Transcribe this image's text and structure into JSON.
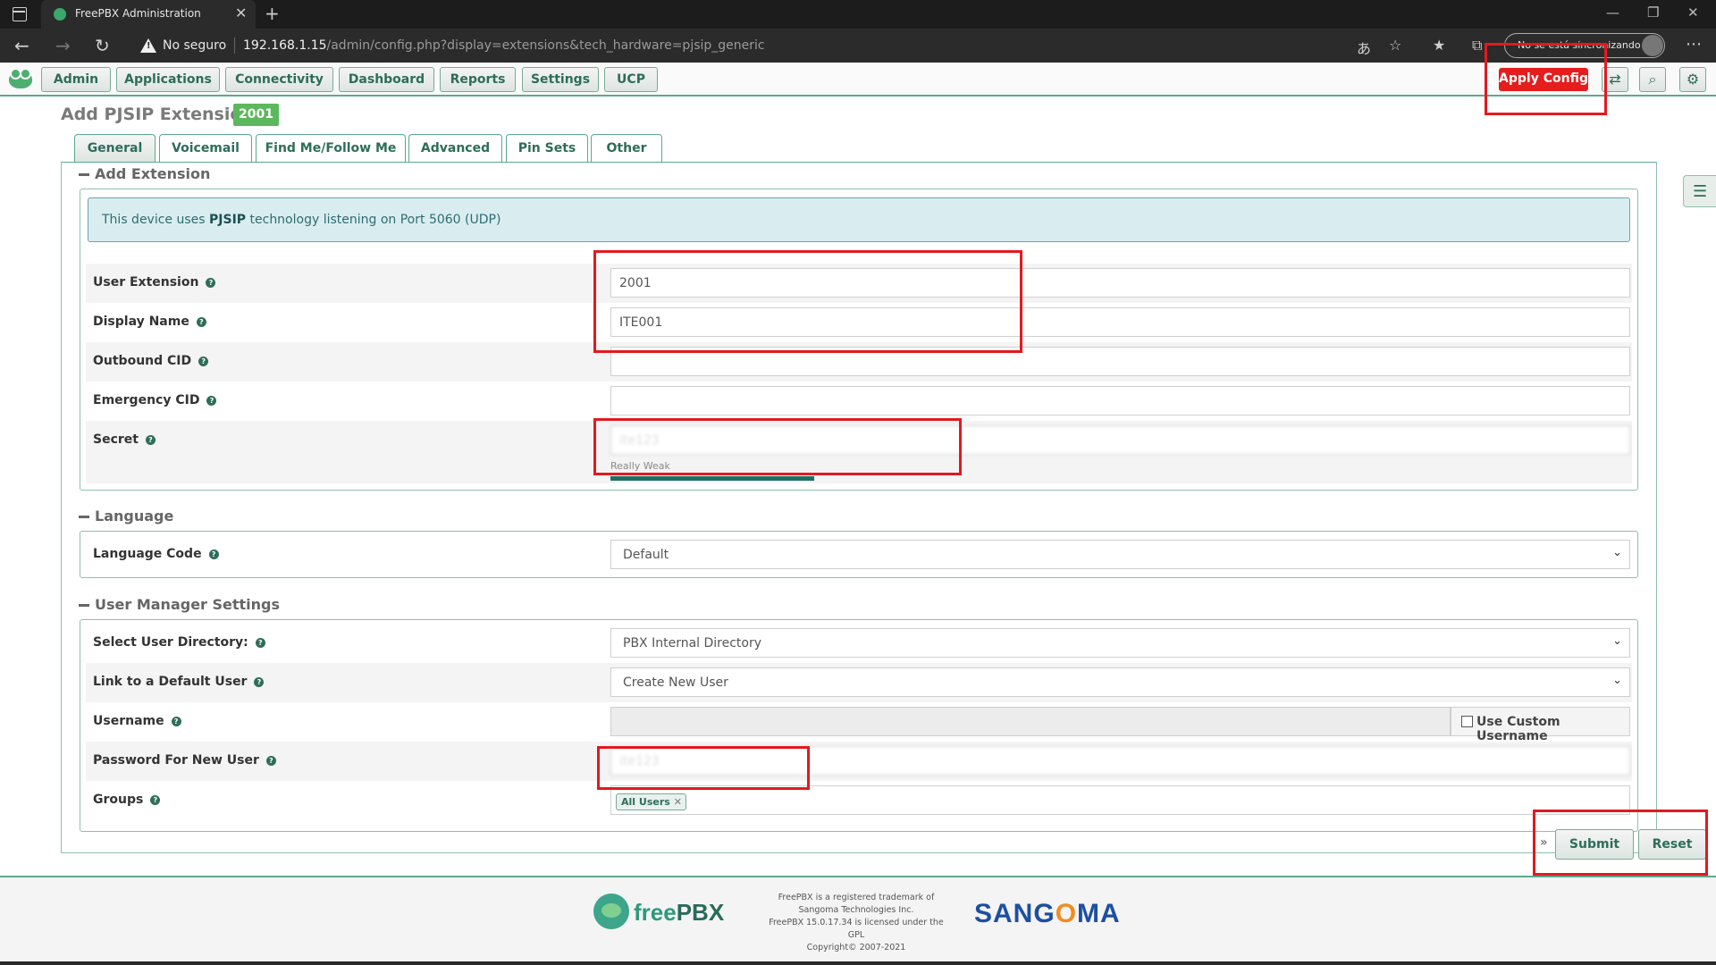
{
  "browser": {
    "tab_title": "FreePBX Administration",
    "not_secure": "No seguro",
    "url_host": "192.168.1.15",
    "url_path": "/admin/config.php?display=extensions&tech_hardware=pjsip_generic",
    "sync_status": "No se está sincronizando"
  },
  "nav": {
    "menu": [
      "Admin",
      "Applications",
      "Connectivity",
      "Dashboard",
      "Reports",
      "Settings",
      "UCP"
    ],
    "apply_config": "Apply Config"
  },
  "page": {
    "title": "Add PJSIP Extension",
    "extension_badge": "2001",
    "tabs": [
      "General",
      "Voicemail",
      "Find Me/Follow Me",
      "Advanced",
      "Pin Sets",
      "Other"
    ],
    "active_tab": "General"
  },
  "add_extension": {
    "heading": "Add Extension",
    "info_prefix": "This device uses ",
    "info_tech": "PJSIP",
    "info_suffix": " technology listening on Port 5060 (UDP)",
    "fields": {
      "user_extension": {
        "label": "User Extension",
        "value": "2001"
      },
      "display_name": {
        "label": "Display Name",
        "value": "ITE001"
      },
      "outbound_cid": {
        "label": "Outbound CID",
        "value": ""
      },
      "emergency_cid": {
        "label": "Emergency CID",
        "value": ""
      },
      "secret": {
        "label": "Secret",
        "value": "ite123",
        "strength": "Really Weak"
      }
    }
  },
  "language": {
    "heading": "Language",
    "code_label": "Language Code",
    "code_value": "Default"
  },
  "user_manager": {
    "heading": "User Manager Settings",
    "directory_label": "Select User Directory:",
    "directory_value": "PBX Internal Directory",
    "link_label": "Link to a Default User",
    "link_value": "Create New User",
    "username_label": "Username",
    "custom_username": "Use Custom Username",
    "password_label": "Password For New User",
    "password_value": "ite123",
    "groups_label": "Groups",
    "group_chip": "All Users"
  },
  "actions": {
    "submit": "Submit",
    "reset": "Reset"
  },
  "footer": {
    "logo_free": "free",
    "logo_pbx": "PBX",
    "line1": "FreePBX is a registered trademark of",
    "line2": "Sangoma Technologies Inc.",
    "line3": "FreePBX 15.0.17.34 is licensed under the",
    "line4": "GPL",
    "line5": "Copyright© 2007-2021",
    "sangoma_1": "SANG",
    "sangoma_o": "O",
    "sangoma_2": "MA"
  },
  "colors": {
    "accent_green": "#2e6d5a",
    "apply_red": "#e51d1d",
    "annotation_red": "#e3191f",
    "badge_green": "#5cb85c"
  }
}
